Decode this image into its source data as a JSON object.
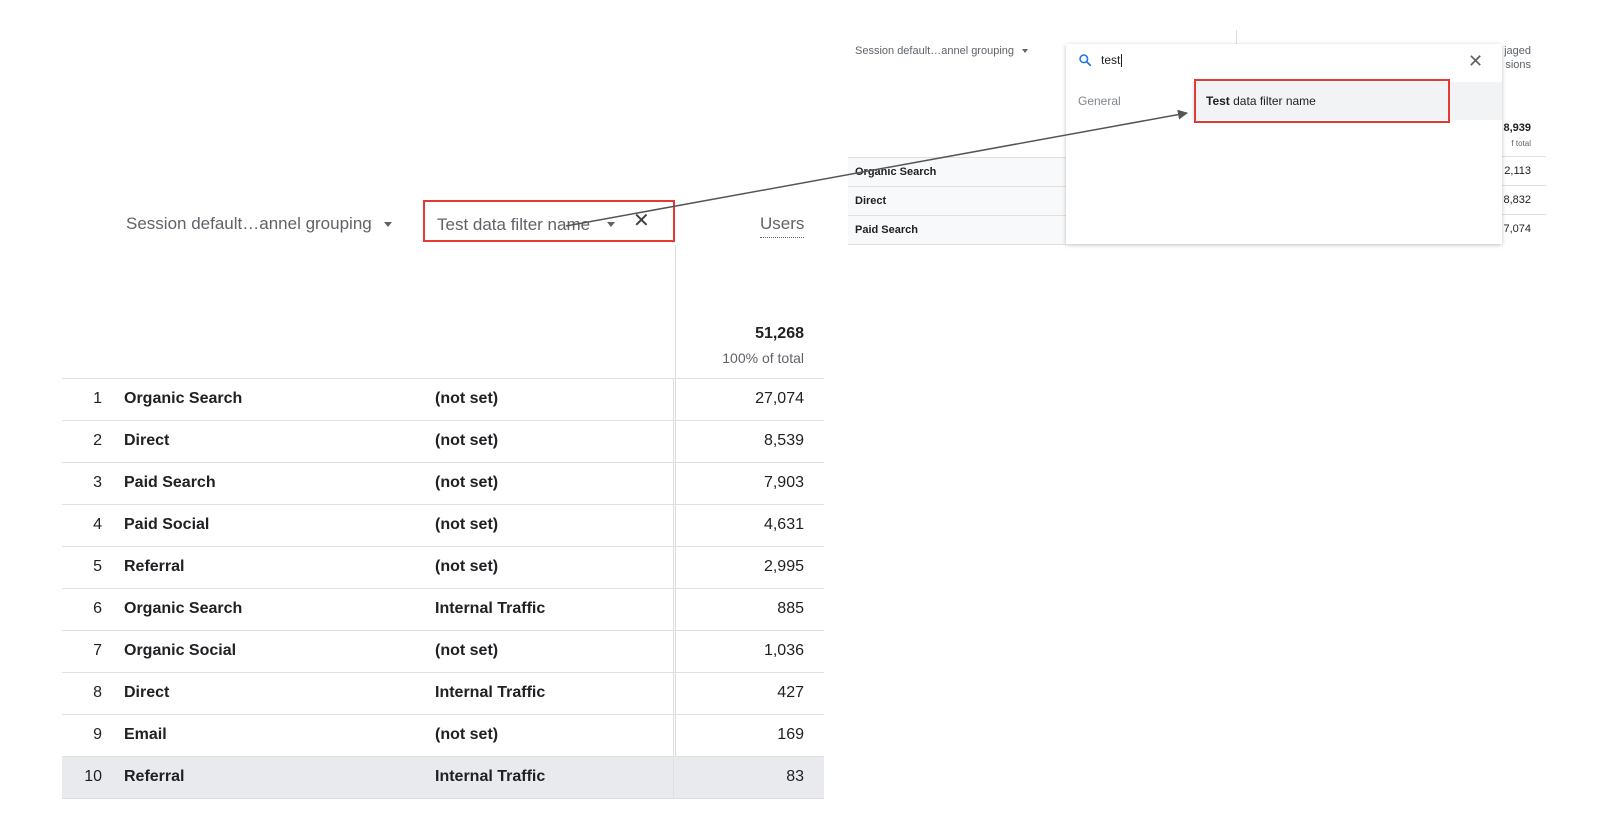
{
  "table": {
    "dimension_header": "Session default…annel grouping",
    "filter_header": "Test data filter name",
    "metric_header": "Users",
    "total_value": "51,268",
    "total_pct": "100% of total",
    "rows": [
      {
        "n": "1",
        "channel": "Organic Search",
        "filter": "(not set)",
        "users": "27,074"
      },
      {
        "n": "2",
        "channel": "Direct",
        "filter": "(not set)",
        "users": "8,539"
      },
      {
        "n": "3",
        "channel": "Paid Search",
        "filter": "(not set)",
        "users": "7,903"
      },
      {
        "n": "4",
        "channel": "Paid Social",
        "filter": "(not set)",
        "users": "4,631"
      },
      {
        "n": "5",
        "channel": "Referral",
        "filter": "(not set)",
        "users": "2,995"
      },
      {
        "n": "6",
        "channel": "Organic Search",
        "filter": "Internal Traffic",
        "users": "885"
      },
      {
        "n": "7",
        "channel": "Organic Social",
        "filter": "(not set)",
        "users": "1,036"
      },
      {
        "n": "8",
        "channel": "Direct",
        "filter": "Internal Traffic",
        "users": "427"
      },
      {
        "n": "9",
        "channel": "Email",
        "filter": "(not set)",
        "users": "169"
      },
      {
        "n": "10",
        "channel": "Referral",
        "filter": "Internal Traffic",
        "users": "83"
      }
    ]
  },
  "inset": {
    "dimension_header": "Session default…annel grouping",
    "search_query": "test",
    "category": "General",
    "option_bold": "Test",
    "option_rest": " data filter name",
    "right_header_line1": "jaged",
    "right_header_line2": "sions",
    "right_total": "8,939",
    "right_pct": "f total",
    "rows": [
      {
        "channel": "Organic Search",
        "value": "2,113"
      },
      {
        "channel": "Direct",
        "value": "8,832"
      },
      {
        "channel": "Paid Search",
        "value": "7,074"
      }
    ]
  },
  "colors": {
    "highlight_border": "#e53935",
    "arrow": "#555555",
    "search_icon": "#1a73e8"
  }
}
